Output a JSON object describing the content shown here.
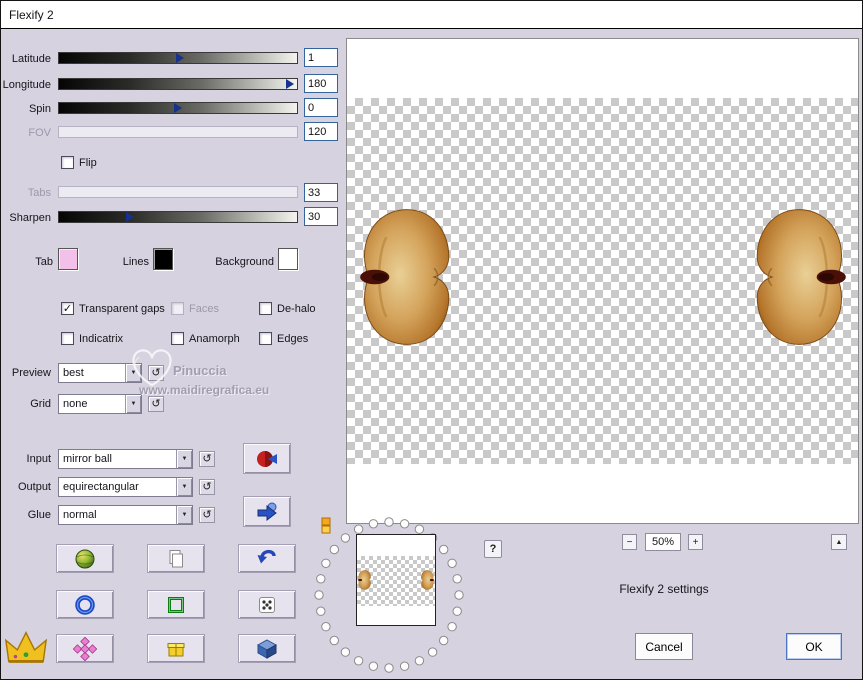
{
  "window": {
    "title": "Flexify 2"
  },
  "icons": {
    "reset": "↺",
    "dropdown_arrow": "▼",
    "check": "✓",
    "help": "?",
    "zoom_out": "−",
    "zoom_in": "+",
    "scroll_up": "▲"
  },
  "sliders": [
    {
      "label": "Latitude",
      "value": "1",
      "marker_pct": 51,
      "enabled": true
    },
    {
      "label": "Longitude",
      "value": "180",
      "marker_pct": 97,
      "enabled": true
    },
    {
      "label": "Spin",
      "value": "0",
      "marker_pct": 50,
      "enabled": true
    },
    {
      "label": "FOV",
      "value": "120",
      "enabled": false
    },
    {
      "label": "Tabs",
      "value": "33",
      "enabled": false
    },
    {
      "label": "Sharpen",
      "value": "30",
      "marker_pct": 30,
      "enabled": true
    }
  ],
  "checkboxes": {
    "flip": {
      "label": "Flip",
      "check": ""
    },
    "transparent_gaps": {
      "label": "Transparent gaps",
      "check": "✓"
    },
    "faces": {
      "label": "Faces",
      "check": ""
    },
    "dehalo": {
      "label": "De-halo",
      "check": ""
    },
    "indicatrix": {
      "label": "Indicatrix",
      "check": ""
    },
    "anamorph": {
      "label": "Anamorph",
      "check": ""
    },
    "edges": {
      "label": "Edges",
      "check": ""
    }
  },
  "swatches": [
    {
      "label": "Tab",
      "color": "#f2c0e9"
    },
    {
      "label": "Lines",
      "color": "#000000"
    },
    {
      "label": "Background",
      "color": "#ffffff"
    }
  ],
  "dropdowns": {
    "preview": {
      "label": "Preview",
      "value": "best"
    },
    "grid": {
      "label": "Grid",
      "value": "none"
    },
    "input": {
      "label": "Input",
      "value": "mirror ball"
    },
    "output": {
      "label": "Output",
      "value": "equirectangular"
    },
    "glue": {
      "label": "Glue",
      "value": "normal"
    }
  },
  "watermark": {
    "name": "Pinuccia",
    "url": "www.maidiregrafica.eu"
  },
  "preview_controls": {
    "zoom_level": "50%"
  },
  "status_text": "Flexify 2 settings",
  "actions": {
    "cancel": "Cancel",
    "ok": "OK"
  },
  "colors": {
    "dialog_bg": "#d6d2e0",
    "butterfly_tan": "#d4a35b",
    "butterfly_eye": "#4a0f06"
  }
}
